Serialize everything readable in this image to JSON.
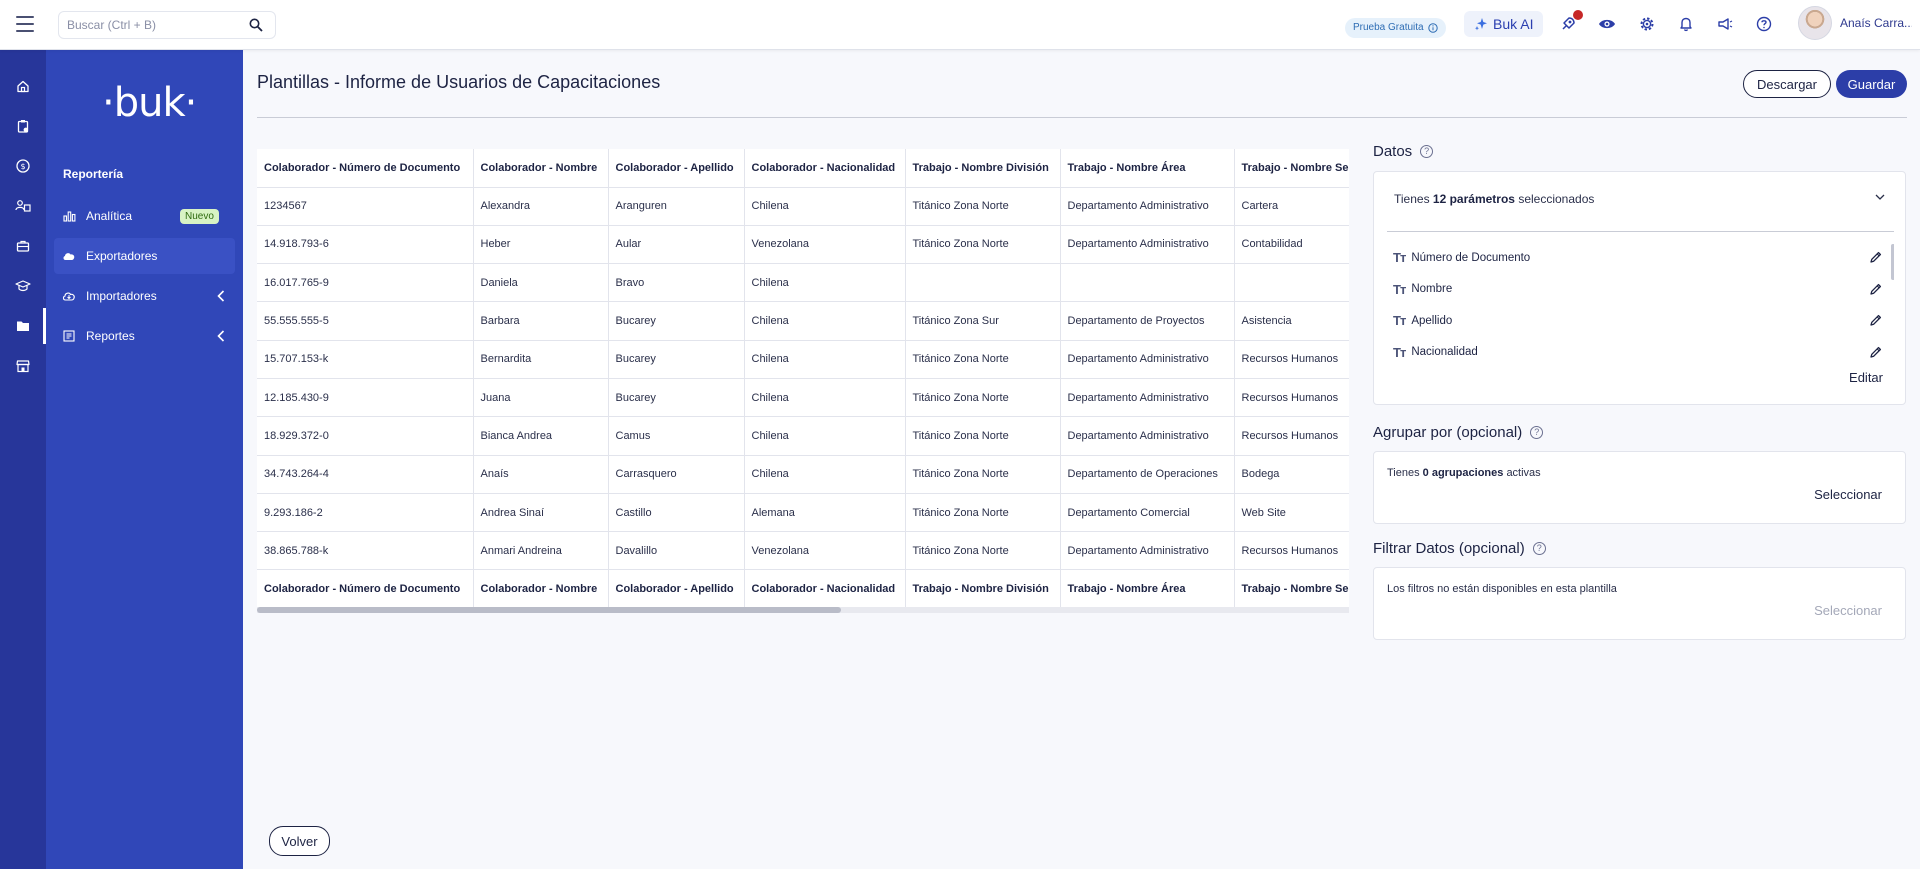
{
  "topbar": {
    "search_placeholder": "Buscar (Ctrl + B)",
    "trial_label": "Prueba Gratuita",
    "ai_label": "Buk AI",
    "user_name": "Anaís Carra..."
  },
  "sidebar": {
    "logo": "·buk·",
    "section_title": "Reportería",
    "items": [
      {
        "label": "Analítica",
        "badge": "Nuevo"
      },
      {
        "label": "Exportadores"
      },
      {
        "label": "Importadores"
      },
      {
        "label": "Reportes"
      }
    ]
  },
  "page": {
    "title": "Plantillas - Informe de Usuarios de Capacitaciones",
    "download_label": "Descargar",
    "save_label": "Guardar",
    "back_label": "Volver"
  },
  "table": {
    "columns": [
      "Colaborador - Número de Documento",
      "Colaborador - Nombre",
      "Colaborador - Apellido",
      "Colaborador - Nacionalidad",
      "Trabajo - Nombre División",
      "Trabajo - Nombre Área",
      "Trabajo - Nombre Sección"
    ],
    "rows": [
      [
        "1234567",
        "Alexandra",
        "Aranguren",
        "Chilena",
        "Titánico Zona Norte",
        "Departamento Administrativo",
        "Cartera"
      ],
      [
        "14.918.793-6",
        "Heber",
        "Aular",
        "Venezolana",
        "Titánico Zona Norte",
        "Departamento Administrativo",
        "Contabilidad"
      ],
      [
        "16.017.765-9",
        "Daniela",
        "Bravo",
        "Chilena",
        "",
        "",
        ""
      ],
      [
        "55.555.555-5",
        "Barbara",
        "Bucarey",
        "Chilena",
        "Titánico Zona Sur",
        "Departamento de Proyectos",
        "Asistencia"
      ],
      [
        "15.707.153-k",
        "Bernardita",
        "Bucarey",
        "Chilena",
        "Titánico Zona Norte",
        "Departamento Administrativo",
        "Recursos Humanos"
      ],
      [
        "12.185.430-9",
        "Juana",
        "Bucarey",
        "Chilena",
        "Titánico Zona Norte",
        "Departamento Administrativo",
        "Recursos Humanos"
      ],
      [
        "18.929.372-0",
        "Bianca Andrea",
        "Camus",
        "Chilena",
        "Titánico Zona Norte",
        "Departamento Administrativo",
        "Recursos Humanos"
      ],
      [
        "34.743.264-4",
        "Anaís",
        "Carrasquero",
        "Chilena",
        "Titánico Zona Norte",
        "Departamento de Operaciones",
        "Bodega"
      ],
      [
        "9.293.186-2",
        "Andrea Sinaí",
        "Castillo",
        "Alemana",
        "Titánico Zona Norte",
        "Departamento Comercial",
        "Web Site"
      ],
      [
        "38.865.788-k",
        "Anmari Andreina",
        "Davalillo",
        "Venezolana",
        "Titánico Zona Norte",
        "Departamento Administrativo",
        "Recursos Humanos"
      ]
    ]
  },
  "datos": {
    "heading": "Datos",
    "summary_prefix": "Tienes",
    "summary_bold": "12 parámetros",
    "summary_suffix": "seleccionados",
    "params": [
      "Número de Documento",
      "Nombre",
      "Apellido",
      "Nacionalidad"
    ],
    "type_glyph": "Tт",
    "edit_label": "Editar"
  },
  "agrupar": {
    "heading": "Agrupar por (opcional)",
    "text_prefix": "Tienes",
    "text_bold": "0 agrupaciones",
    "text_suffix": "activas",
    "select_label": "Seleccionar"
  },
  "filtrar": {
    "heading": "Filtrar Datos (opcional)",
    "text": "Los filtros no están disponibles en esta plantilla",
    "select_label": "Seleccionar"
  }
}
